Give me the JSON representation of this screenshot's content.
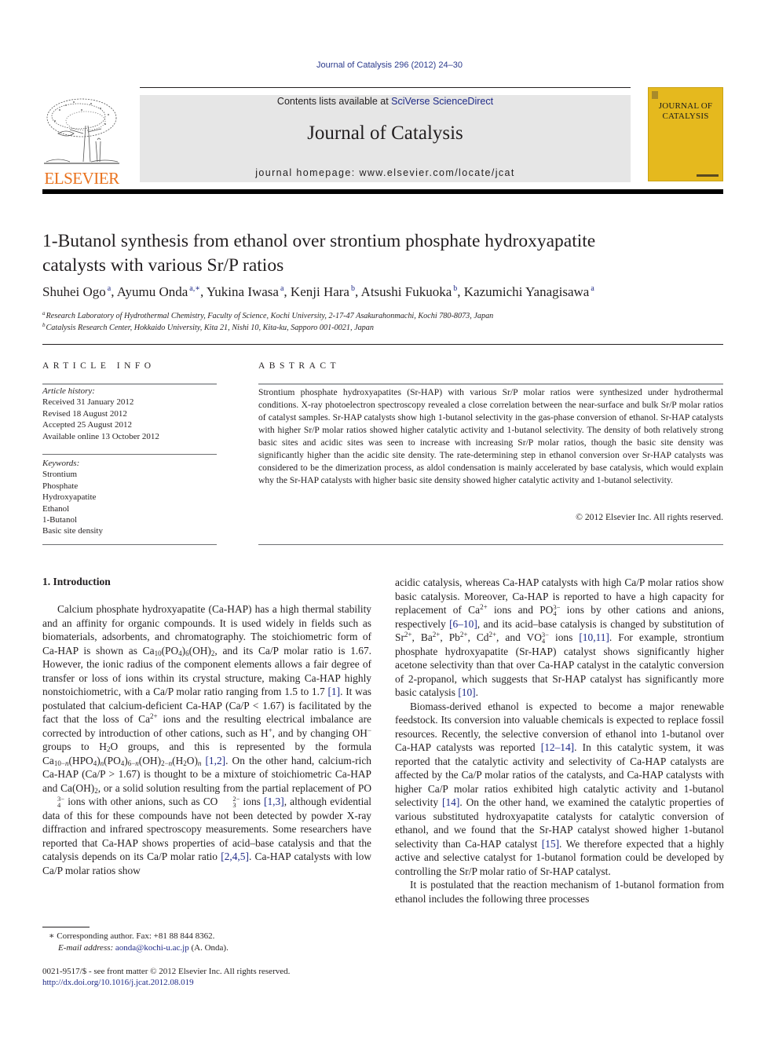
{
  "header": {
    "citation": "Journal of Catalysis 296 (2012) 24–30",
    "publisher_logo_text": "ELSEVIER",
    "contents_prefix": "Contents lists available at ",
    "contents_link": "SciVerse ScienceDirect",
    "journal_name": "Journal of Catalysis",
    "homepage": "journal homepage: www.elsevier.com/locate/jcat",
    "cover_title_line1": "JOURNAL OF",
    "cover_title_line2": "CATALYSIS",
    "colors": {
      "logo_orange": "#e9711c",
      "cover_yellow": "#e5b91e",
      "link_blue": "#1f2a87",
      "banner_grey": "#e6e6e6"
    }
  },
  "article": {
    "title_line1": "1-Butanol synthesis from ethanol over strontium phosphate hydroxyapatite",
    "title_line2": "catalysts with various Sr/P ratios",
    "authors": [
      {
        "name": "Shuhei Ogo",
        "aff": "a"
      },
      {
        "name": "Ayumu Onda",
        "aff": "a,∗"
      },
      {
        "name": "Yukina Iwasa",
        "aff": "a"
      },
      {
        "name": "Kenji Hara",
        "aff": "b"
      },
      {
        "name": "Atsushi Fukuoka",
        "aff": "b"
      },
      {
        "name": "Kazumichi Yanagisawa",
        "aff": "a"
      }
    ],
    "affiliations": [
      {
        "mark": "a",
        "text": "Research Laboratory of Hydrothermal Chemistry, Faculty of Science, Kochi University, 2-17-47 Asakurahonmachi, Kochi 780-8073, Japan"
      },
      {
        "mark": "b",
        "text": "Catalysis Research Center, Hokkaido University, Kita 21, Nishi 10, Kita-ku, Sapporo 001-0021, Japan"
      }
    ]
  },
  "article_info": {
    "heading": "ARTICLE INFO",
    "history_label": "Article history:",
    "history": [
      "Received 31 January 2012",
      "Revised 18 August 2012",
      "Accepted 25 August 2012",
      "Available online 13 October 2012"
    ],
    "keywords_label": "Keywords:",
    "keywords": [
      "Strontium",
      "Phosphate",
      "Hydroxyapatite",
      "Ethanol",
      "1-Butanol",
      "Basic site density"
    ]
  },
  "abstract": {
    "heading": "ABSTRACT",
    "text": "Strontium phosphate hydroxyapatites (Sr-HAP) with various Sr/P molar ratios were synthesized under hydrothermal conditions. X-ray photoelectron spectroscopy revealed a close correlation between the near-surface and bulk Sr/P molar ratios of catalyst samples. Sr-HAP catalysts show high 1-butanol selectivity in the gas-phase conversion of ethanol. Sr-HAP catalysts with higher Sr/P molar ratios showed higher catalytic activity and 1-butanol selectivity. The density of both relatively strong basic sites and acidic sites was seen to increase with increasing Sr/P molar ratios, though the basic site density was significantly higher than the acidic site density. The rate-determining step in ethanol conversion over Sr-HAP catalysts was considered to be the dimerization process, as aldol condensation is mainly accelerated by base catalysis, which would explain why the Sr-HAP catalysts with higher basic site density showed higher catalytic activity and 1-butanol selectivity.",
    "copyright": "© 2012 Elsevier Inc. All rights reserved."
  },
  "body": {
    "section_heading": "1. Introduction",
    "left": {
      "p1_a": "Calcium phosphate hydroxyapatite (Ca-HAP) has a high thermal stability and an affinity for organic compounds. It is used widely in fields such as biomaterials, adsorbents, and chromatography. The stoichiometric form of Ca-HAP is shown as Ca",
      "p1_b": ", and its Ca/P molar ratio is 1.67. However, the ionic radius of the component elements allows a fair degree of transfer or loss of ions within its crystal structure, making Ca-HAP highly nonstoichiometric, with a Ca/P molar ratio ranging from 1.5 to 1.7 ",
      "ref1": "[1]",
      "p1_c": ". It was postulated that calcium-deficient Ca-HAP (Ca/P < 1.67) is facilitated by the fact that the loss of Ca",
      "p1_d": " ions and the resulting electrical imbalance are corrected by introduction of other cations, such as H",
      "p1_e": ", and by changing OH",
      "p1_f": " groups to H",
      "p1_g": "O groups, and this is represented by the formula Ca",
      "ref12": "[1,2]",
      "p1_h": ". On the other hand, calcium-rich Ca-HAP (Ca/P > 1.67) is thought to be a mixture of stoichiometric Ca-HAP and Ca(OH)",
      "p1_i": ", or a solid solution resulting from the partial replacement of PO",
      "p1_j": " ions with other anions, such as CO",
      "p1_k": " ions ",
      "ref13": "[1,3]",
      "p1_l": ", although evidential data of this for these compounds have not been detected by powder X-ray diffraction and infrared spectroscopy measurements. Some researchers have reported that Ca-HAP shows properties of acid–base catalysis and that the catalysis depends on its Ca/P molar ratio ",
      "ref245": "[2,4,5]",
      "p1_m": ". Ca-HAP catalysts with low Ca/P molar ratios show"
    },
    "right": {
      "p1_a": "acidic catalysis, whereas Ca-HAP catalysts with high Ca/P molar ratios show basic catalysis. Moreover, Ca-HAP is reported to have a high capacity for replacement of Ca",
      "p1_b": " ions and PO",
      "p1_c": " ions by other cations and anions, respectively ",
      "ref610": "[6–10]",
      "p1_d": ", and its acid–base catalysis is changed by substitution of Sr",
      "p1_e": ", Ba",
      "p1_f": ", Pb",
      "p1_g": ", Cd",
      "p1_h": ", and VO",
      "p1_i": " ions ",
      "ref1011": "[10,11]",
      "p1_j": ". For example, strontium phosphate hydroxyapatite (Sr-HAP) catalyst shows significantly higher acetone selectivity than that over Ca-HAP catalyst in the catalytic conversion of 2-propanol, which suggests that Sr-HAP catalyst has significantly more basic catalysis ",
      "ref10": "[10]",
      "p2_a": "Biomass-derived ethanol is expected to become a major renewable feedstock. Its conversion into valuable chemicals is expected to replace fossil resources. Recently, the selective conversion of ethanol into 1-butanol over Ca-HAP catalysts was reported ",
      "ref1214": "[12–14]",
      "p2_b": ". In this catalytic system, it was reported that the catalytic activity and selectivity of Ca-HAP catalysts are affected by the Ca/P molar ratios of the catalysts, and Ca-HAP catalysts with higher Ca/P molar ratios exhibited high catalytic activity and 1-butanol selectivity ",
      "ref14": "[14]",
      "p2_c": ". On the other hand, we examined the catalytic properties of various substituted hydroxyapatite catalysts for catalytic conversion of ethanol, and we found that the Sr-HAP catalyst showed higher 1-butanol selectivity than Ca-HAP catalyst ",
      "ref15": "[15]",
      "p2_d": ". We therefore expected that a highly active and selective catalyst for 1-butanol formation could be developed by controlling the Sr/P molar ratio of Sr-HAP catalyst.",
      "p3": "It is postulated that the reaction mechanism of 1-butanol formation from ethanol includes the following three processes"
    }
  },
  "footnotes": {
    "corresponding": "∗  Corresponding author. Fax: +81 88 844 8362.",
    "email_label": "E-mail address: ",
    "email": "aonda@kochi-u.ac.jp",
    "email_suffix": " (A. Onda).",
    "issn": "0021-9517/$ - see front matter © 2012 Elsevier Inc. All rights reserved.",
    "doi": "http://dx.doi.org/10.1016/j.jcat.2012.08.019"
  }
}
